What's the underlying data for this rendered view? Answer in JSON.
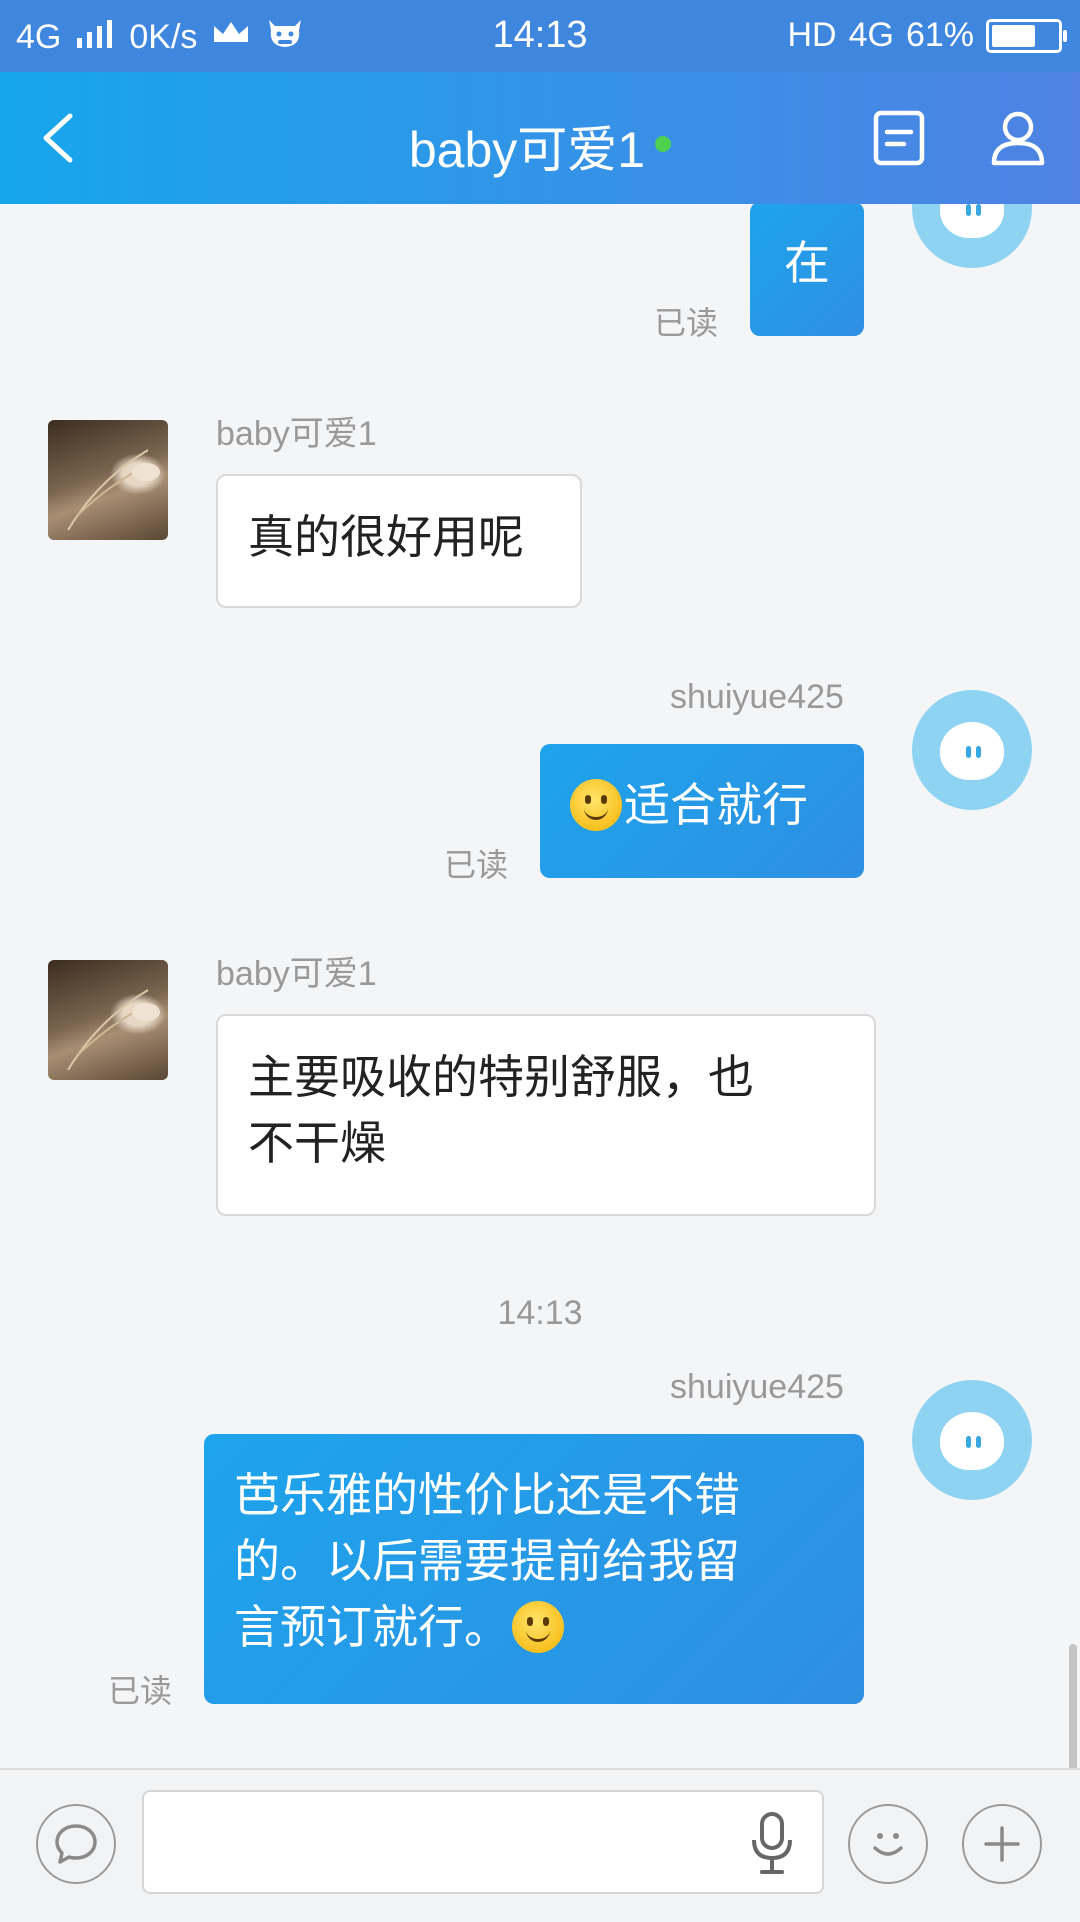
{
  "status_bar": {
    "network": "4G",
    "speed": "0K/s",
    "time": "14:13",
    "hd": "HD",
    "network_right": "4G",
    "battery_percent": "61%",
    "battery_level": 0.61
  },
  "navbar": {
    "title": "baby可爱1",
    "online": true
  },
  "messages": [
    {
      "side": "out",
      "text": "在",
      "read": "已读"
    },
    {
      "side": "in",
      "sender": "baby可爱1",
      "text": "真的很好用呢"
    },
    {
      "side": "out",
      "sender": "shuiyue425",
      "emoji": "smiley-icon",
      "text": "适合就行",
      "read": "已读"
    },
    {
      "side": "in",
      "sender": "baby可爱1",
      "lines": [
        "主要吸收的特别舒服，也",
        "不干燥"
      ]
    },
    {
      "side": "out",
      "sender": "shuiyue425",
      "lines": [
        "芭乐雅的性价比还是不错",
        "的。以后需要提前给我留",
        "言预订就行。"
      ],
      "emoji": "smiley-icon",
      "read": "已读"
    }
  ],
  "timestamp": "14:13",
  "input": {
    "value": "",
    "placeholder": ""
  },
  "colors": {
    "status_bar": "#3f86de",
    "navbar_start": "#16a6ec",
    "navbar_end": "#4f82e3",
    "bubble_out": "#1da4ec",
    "online_dot": "#4dd04d"
  }
}
